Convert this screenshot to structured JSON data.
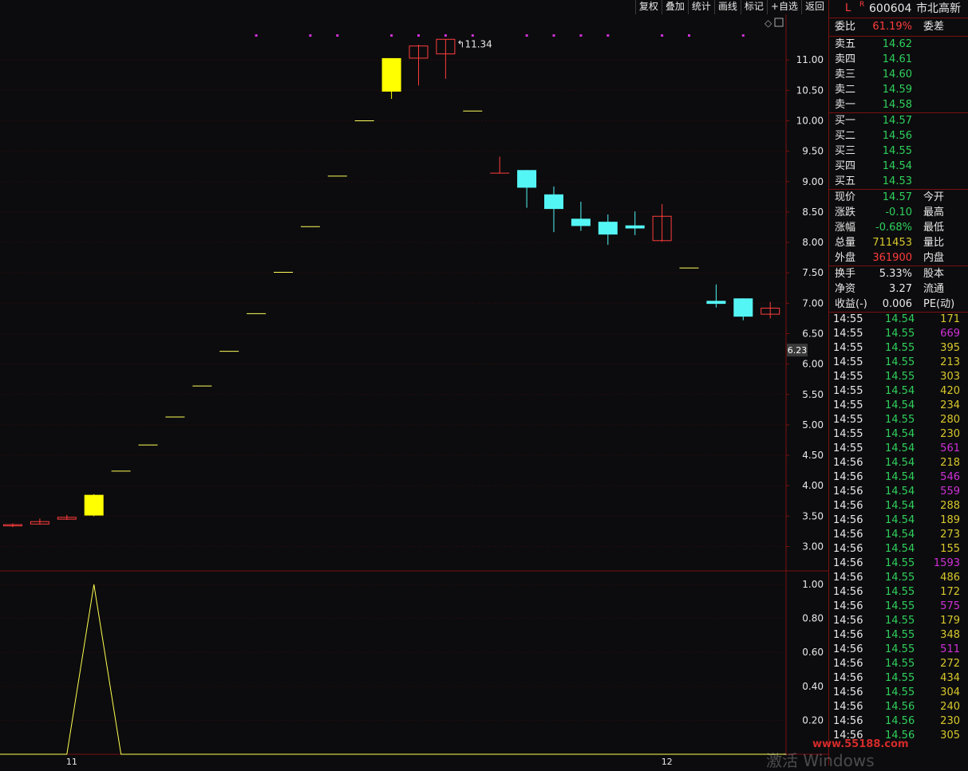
{
  "toolbar": [
    "复权",
    "叠加",
    "统计",
    "画线",
    "标记",
    "+自选",
    "返回"
  ],
  "stock": {
    "flag": "L",
    "badge": "R",
    "code": "600604",
    "name": "市北高新"
  },
  "order_ratio": {
    "label": "委比",
    "value": "61.19%",
    "diff_label": "委差"
  },
  "asks": [
    {
      "label": "卖五",
      "price": "14.62"
    },
    {
      "label": "卖四",
      "price": "14.61"
    },
    {
      "label": "卖三",
      "price": "14.60"
    },
    {
      "label": "卖二",
      "price": "14.59"
    },
    {
      "label": "卖一",
      "price": "14.58"
    }
  ],
  "bids": [
    {
      "label": "买一",
      "price": "14.57"
    },
    {
      "label": "买二",
      "price": "14.56"
    },
    {
      "label": "买三",
      "price": "14.55"
    },
    {
      "label": "买四",
      "price": "14.54"
    },
    {
      "label": "买五",
      "price": "14.53"
    }
  ],
  "quote": [
    {
      "label": "现价",
      "value": "14.57",
      "label2": "今开",
      "color": "g"
    },
    {
      "label": "涨跌",
      "value": "-0.10",
      "label2": "最高",
      "color": "g"
    },
    {
      "label": "涨幅",
      "value": "-0.68%",
      "label2": "最低",
      "color": "g"
    },
    {
      "label": "总量",
      "value": "711453",
      "label2": "量比",
      "color": "y"
    },
    {
      "label": "外盘",
      "value": "361900",
      "label2": "内盘",
      "color": "r"
    }
  ],
  "stats": [
    {
      "label": "换手",
      "value": "5.33%",
      "label2": "股本"
    },
    {
      "label": "净资",
      "value": "3.27",
      "label2": "流通"
    },
    {
      "label": "收益(-)",
      "value": "0.006",
      "label2": "PE(动)"
    }
  ],
  "ticks": [
    [
      "14:55",
      "14.54",
      "171",
      "g",
      "y"
    ],
    [
      "14:55",
      "14.55",
      "669",
      "g",
      "m"
    ],
    [
      "14:55",
      "14.55",
      "395",
      "g",
      "y"
    ],
    [
      "14:55",
      "14.55",
      "213",
      "g",
      "y"
    ],
    [
      "14:55",
      "14.55",
      "303",
      "g",
      "y"
    ],
    [
      "14:55",
      "14.54",
      "420",
      "g",
      "y"
    ],
    [
      "14:55",
      "14.54",
      "234",
      "g",
      "y"
    ],
    [
      "14:55",
      "14.55",
      "280",
      "g",
      "y"
    ],
    [
      "14:55",
      "14.54",
      "230",
      "g",
      "y"
    ],
    [
      "14:55",
      "14.54",
      "561",
      "g",
      "m"
    ],
    [
      "14:56",
      "14.54",
      "218",
      "g",
      "y"
    ],
    [
      "14:56",
      "14.54",
      "546",
      "g",
      "m"
    ],
    [
      "14:56",
      "14.54",
      "559",
      "g",
      "m"
    ],
    [
      "14:56",
      "14.54",
      "288",
      "g",
      "y"
    ],
    [
      "14:56",
      "14.54",
      "189",
      "g",
      "y"
    ],
    [
      "14:56",
      "14.54",
      "273",
      "g",
      "y"
    ],
    [
      "14:56",
      "14.54",
      "155",
      "g",
      "y"
    ],
    [
      "14:56",
      "14.55",
      "1593",
      "g",
      "m"
    ],
    [
      "14:56",
      "14.55",
      "486",
      "g",
      "y"
    ],
    [
      "14:56",
      "14.55",
      "172",
      "g",
      "y"
    ],
    [
      "14:56",
      "14.55",
      "575",
      "g",
      "m"
    ],
    [
      "14:56",
      "14.55",
      "179",
      "g",
      "y"
    ],
    [
      "14:56",
      "14.55",
      "348",
      "g",
      "y"
    ],
    [
      "14:56",
      "14.55",
      "511",
      "g",
      "m"
    ],
    [
      "14:56",
      "14.55",
      "272",
      "g",
      "y"
    ],
    [
      "14:56",
      "14.55",
      "434",
      "g",
      "y"
    ],
    [
      "14:56",
      "14.55",
      "304",
      "g",
      "y"
    ],
    [
      "14:56",
      "14.56",
      "240",
      "g",
      "y"
    ],
    [
      "14:56",
      "14.56",
      "230",
      "g",
      "y"
    ],
    [
      "14:56",
      "14.56",
      "305",
      "g",
      "y"
    ]
  ],
  "chart_data": {
    "type": "candlestick",
    "price_axis_ticks": [
      "11.00",
      "10.50",
      "10.00",
      "9.50",
      "9.00",
      "8.50",
      "8.00",
      "7.50",
      "7.00",
      "6.50",
      "6.00",
      "5.50",
      "5.00",
      "4.50",
      "4.00",
      "3.50",
      "3.00"
    ],
    "price_ylim": [
      2.6,
      11.75
    ],
    "current_price_label": "6.23",
    "high_label": "11.34",
    "candles": [
      {
        "o": 3.34,
        "c": 3.36,
        "h": 3.38,
        "l": 3.32
      },
      {
        "o": 3.37,
        "c": 3.41,
        "h": 3.46,
        "l": 3.36
      },
      {
        "o": 3.45,
        "c": 3.48,
        "h": 3.52,
        "l": 3.44
      },
      {
        "o": 3.51,
        "c": 3.85,
        "h": 3.86,
        "l": 3.5,
        "limit": true
      },
      {
        "o": 4.24,
        "c": 4.24,
        "h": 4.24,
        "l": 4.24
      },
      {
        "o": 4.67,
        "c": 4.67,
        "h": 4.67,
        "l": 4.67
      },
      {
        "o": 5.13,
        "c": 5.13,
        "h": 5.13,
        "l": 5.13
      },
      {
        "o": 5.64,
        "c": 5.64,
        "h": 5.64,
        "l": 5.64
      },
      {
        "o": 6.21,
        "c": 6.21,
        "h": 6.21,
        "l": 6.21
      },
      {
        "o": 6.83,
        "c": 6.83,
        "h": 6.83,
        "l": 6.83
      },
      {
        "o": 7.51,
        "c": 7.51,
        "h": 7.51,
        "l": 7.51
      },
      {
        "o": 8.26,
        "c": 8.26,
        "h": 8.26,
        "l": 8.26
      },
      {
        "o": 9.09,
        "c": 9.09,
        "h": 9.09,
        "l": 9.09
      },
      {
        "o": 10.0,
        "c": 10.0,
        "h": 10.0,
        "l": 10.0
      },
      {
        "o": 10.48,
        "c": 11.03,
        "h": 11.03,
        "l": 10.36,
        "limit": true
      },
      {
        "o": 11.03,
        "c": 11.23,
        "h": 11.25,
        "l": 10.58
      },
      {
        "o": 11.1,
        "c": 11.34,
        "h": 11.34,
        "l": 10.69
      },
      {
        "o": 10.16,
        "c": 10.16,
        "h": 10.16,
        "l": 10.16
      },
      {
        "o": 9.14,
        "c": 9.14,
        "h": 9.41,
        "l": 9.14
      },
      {
        "o": 9.19,
        "c": 8.9,
        "h": 9.19,
        "l": 8.57
      },
      {
        "o": 8.79,
        "c": 8.55,
        "h": 8.92,
        "l": 8.17
      },
      {
        "o": 8.39,
        "c": 8.27,
        "h": 8.67,
        "l": 8.19
      },
      {
        "o": 8.34,
        "c": 8.13,
        "h": 8.46,
        "l": 7.96
      },
      {
        "o": 8.28,
        "c": 8.23,
        "h": 8.51,
        "l": 8.12
      },
      {
        "o": 8.03,
        "c": 8.43,
        "h": 8.63,
        "l": 8.01
      },
      {
        "o": 7.58,
        "c": 7.58,
        "h": 7.58,
        "l": 7.58
      },
      {
        "o": 7.04,
        "c": 6.99,
        "h": 7.31,
        "l": 6.93
      },
      {
        "o": 7.08,
        "c": 6.78,
        "h": 7.08,
        "l": 6.72
      },
      {
        "o": 6.82,
        "c": 6.92,
        "h": 7.02,
        "l": 6.75
      }
    ],
    "signal_dots_at": [
      9,
      11,
      12,
      14,
      15,
      16,
      17,
      19,
      20,
      21,
      22,
      24,
      25,
      27
    ],
    "indicator_axis_ticks": [
      "1.00",
      "0.80",
      "0.60",
      "0.40",
      "0.20"
    ],
    "indicator_ylim": [
      0,
      1.08
    ],
    "indicator_values": [
      0,
      0,
      0,
      1,
      0,
      0,
      0,
      0,
      0,
      0,
      0,
      0,
      0,
      0,
      0,
      0,
      0,
      0,
      0,
      0,
      0,
      0,
      0,
      0,
      0,
      0,
      0,
      0,
      0
    ],
    "x_labels": [
      {
        "index": 1,
        "text": "11"
      },
      {
        "index": 23,
        "text": "12"
      }
    ]
  },
  "watermark": {
    "text": "激活 Windows",
    "site": "www.55188.com"
  },
  "colors": {
    "up": "#ff3c3c",
    "down": "#54f5f5",
    "limit": "#ffff00",
    "axis": "#7a1010",
    "flat": "#ffff5a"
  }
}
